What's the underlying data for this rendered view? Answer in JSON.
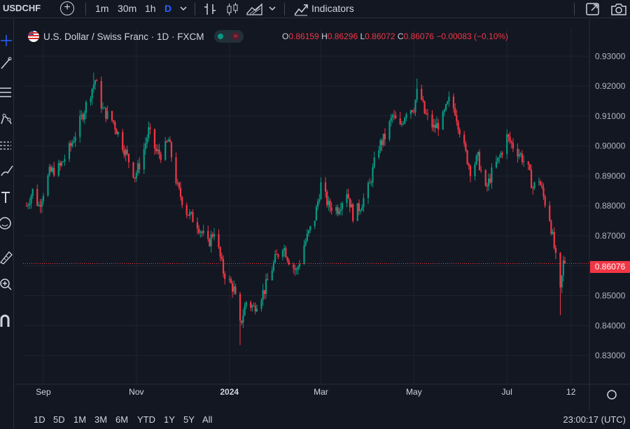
{
  "toolbar": {
    "symbol": "USDCHF",
    "intervals": [
      "1m",
      "30m",
      "1h",
      "D"
    ],
    "active_interval": "D",
    "indicators_label": "Indicators",
    "icons": [
      "add-symbol-icon",
      "chevron-down-icon",
      "bar-style-icon",
      "candles-icon",
      "area-icon",
      "indicators-icon",
      "fullscreen-icon",
      "camera-icon"
    ]
  },
  "left_toolbar": {
    "icons": [
      "crosshair-icon",
      "trend-line-icon",
      "fib-icon",
      "patterns-icon",
      "forecast-icon",
      "brush-icon",
      "text-icon",
      "emoji-icon",
      "ruler-icon",
      "zoom-icon",
      "magnet-icon"
    ]
  },
  "legend": {
    "title": "U.S. Dollar / Swiss Franc · 1D · FXCM",
    "open_label": "O",
    "open": "0.86159",
    "high_label": "H",
    "high": "0.86296",
    "low_label": "L",
    "low": "0.86072",
    "close_label": "C",
    "close": "0.86076",
    "change": "−0.00083 (−0.10%)",
    "up_color": "#089981",
    "down_color": "#f23645"
  },
  "price_label": "0.86076",
  "bottom": {
    "ranges": [
      "1D",
      "5D",
      "1M",
      "3M",
      "6M",
      "YTD",
      "1Y",
      "5Y",
      "All"
    ],
    "clock": "23:00:17 (UTC)"
  },
  "chart_data": {
    "type": "candlestick",
    "title": "U.S. Dollar / Swiss Franc · 1D · FXCM",
    "y_ticks": [
      "0.93000",
      "0.92000",
      "0.91000",
      "0.90000",
      "0.89000",
      "0.88000",
      "0.87000",
      "0.86000",
      "0.85000",
      "0.84000",
      "0.83000"
    ],
    "x_ticks": [
      "Sep",
      "Nov",
      "2024",
      "Mar",
      "May",
      "Jul",
      "12"
    ],
    "ylim": [
      0.8265,
      0.9345
    ],
    "last_price": 0.86076,
    "grid": true,
    "path": [
      [
        "2023-08-21",
        0.88
      ],
      [
        "2023-08-25",
        0.885
      ],
      [
        "2023-08-29",
        0.88
      ],
      [
        "2023-09-05",
        0.891
      ],
      [
        "2023-09-12",
        0.893
      ],
      [
        "2023-09-19",
        0.9
      ],
      [
        "2023-09-25",
        0.908
      ],
      [
        "2023-10-02",
        0.918
      ],
      [
        "2023-10-05",
        0.922
      ],
      [
        "2023-10-10",
        0.912
      ],
      [
        "2023-10-17",
        0.908
      ],
      [
        "2023-10-24",
        0.899
      ],
      [
        "2023-10-31",
        0.89
      ],
      [
        "2023-11-04",
        0.895
      ],
      [
        "2023-11-09",
        0.905
      ],
      [
        "2023-11-14",
        0.898
      ],
      [
        "2023-11-18",
        0.897
      ],
      [
        "2023-11-22",
        0.902
      ],
      [
        "2023-11-28",
        0.886
      ],
      [
        "2023-12-04",
        0.878
      ],
      [
        "2023-12-11",
        0.874
      ],
      [
        "2023-12-18",
        0.867
      ],
      [
        "2023-12-22",
        0.872
      ],
      [
        "2023-12-28",
        0.858
      ],
      [
        "2024-01-04",
        0.852
      ],
      [
        "2024-01-08",
        0.84
      ],
      [
        "2024-01-12",
        0.848
      ],
      [
        "2024-01-17",
        0.846
      ],
      [
        "2024-01-24",
        0.852
      ],
      [
        "2024-01-31",
        0.862
      ],
      [
        "2024-02-05",
        0.867
      ],
      [
        "2024-02-09",
        0.862
      ],
      [
        "2024-02-14",
        0.858
      ],
      [
        "2024-02-19",
        0.867
      ],
      [
        "2024-02-26",
        0.876
      ],
      [
        "2024-03-01",
        0.887
      ],
      [
        "2024-03-06",
        0.88
      ],
      [
        "2024-03-12",
        0.879
      ],
      [
        "2024-03-18",
        0.885
      ],
      [
        "2024-03-22",
        0.877
      ],
      [
        "2024-03-27",
        0.88
      ],
      [
        "2024-04-02",
        0.887
      ],
      [
        "2024-04-07",
        0.899
      ],
      [
        "2024-04-12",
        0.903
      ],
      [
        "2024-04-17",
        0.91
      ],
      [
        "2024-04-22",
        0.906
      ],
      [
        "2024-04-26",
        0.912
      ],
      [
        "2024-05-01",
        0.913
      ],
      [
        "2024-05-04",
        0.92
      ],
      [
        "2024-05-08",
        0.911
      ],
      [
        "2024-05-14",
        0.906
      ],
      [
        "2024-05-19",
        0.908
      ],
      [
        "2024-05-24",
        0.915
      ],
      [
        "2024-05-28",
        0.912
      ],
      [
        "2024-06-02",
        0.901
      ],
      [
        "2024-06-07",
        0.892
      ],
      [
        "2024-06-12",
        0.896
      ],
      [
        "2024-06-17",
        0.885
      ],
      [
        "2024-06-21",
        0.891
      ],
      [
        "2024-06-26",
        0.896
      ],
      [
        "2024-07-01",
        0.903
      ],
      [
        "2024-07-05",
        0.9
      ],
      [
        "2024-07-10",
        0.897
      ],
      [
        "2024-07-15",
        0.892
      ],
      [
        "2024-07-18",
        0.886
      ],
      [
        "2024-07-22",
        0.889
      ],
      [
        "2024-07-25",
        0.883
      ],
      [
        "2024-07-29",
        0.876
      ],
      [
        "2024-08-01",
        0.866
      ],
      [
        "2024-08-05",
        0.851
      ],
      [
        "2024-08-07",
        0.861
      ],
      [
        "2024-08-08",
        0.8608
      ]
    ]
  }
}
